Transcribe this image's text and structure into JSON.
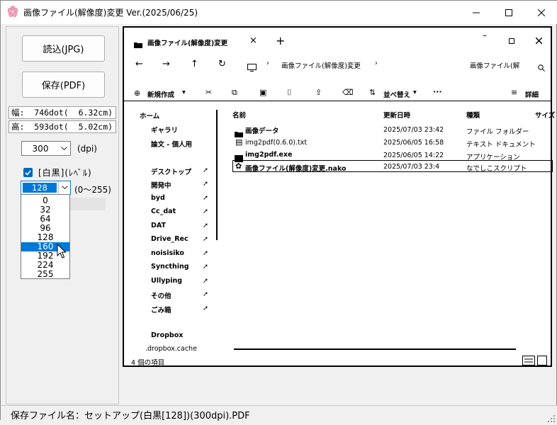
{
  "window": {
    "title": "画像ファイル(解像度)変更 Ver.(2025/06/25)",
    "accent_color": "#0078d7"
  },
  "left_panel": {
    "load_button": "読込(JPG)",
    "save_button": "保存(PDF)",
    "width_readout": "幅:  746dot(  6.32cm)",
    "height_readout": "高:  593dot(  5.02cm)",
    "dpi_value": "300",
    "dpi_unit": "(dpi)",
    "bw_checked": true,
    "bw_label": "[白黒](ﾚﾍﾞﾙ)",
    "level_value": "128",
    "level_range": "(0～255)",
    "level_options": [
      "0",
      "32",
      "64",
      "96",
      "128",
      "160",
      "192",
      "224",
      "255"
    ],
    "level_highlighted": "160"
  },
  "explorer_preview": {
    "tab_title": "画像ファイル(解像度)変更",
    "breadcrumb": "画像ファイル(解像度)変更",
    "search_text": "画像ファイル(解",
    "new_button": "新規作成",
    "sort_button": "並べ替え",
    "view_button": "詳細",
    "nav_items": [
      "ホーム",
      "ギャラリ",
      "論文 - 個人用",
      "デスクトップ",
      "開発中",
      "byd",
      "Cc_dat",
      "DAT",
      "Drive_Rec",
      "noisisiko",
      "Syncthing",
      "Ullyping",
      "その他",
      "ごみ箱",
      "Dropbox",
      ".dropbox.cache"
    ],
    "columns": [
      "名前",
      "更新日時",
      "種類",
      "サイズ"
    ],
    "files": [
      {
        "name": "画像データ",
        "date": "2025/07/03 23:42",
        "type": "ファイル フォルダー"
      },
      {
        "name": "img2pdf(0.6.0).txt",
        "date": "2025/06/05 16:58",
        "type": "テキスト ドキュメント"
      },
      {
        "name": "img2pdf.exe",
        "date": "2025/06/05 14:22",
        "type": "アプリケーション"
      },
      {
        "name": "画像ファイル(解像度)変更.nako",
        "date": "2025/07/03 23:4",
        "type": "なでしこスクリプト"
      }
    ],
    "status": "4 個の項目"
  },
  "status_bar": {
    "save_filename": "保存ファイル名：セットアップ(白黒[128])(300dpi).PDF"
  }
}
